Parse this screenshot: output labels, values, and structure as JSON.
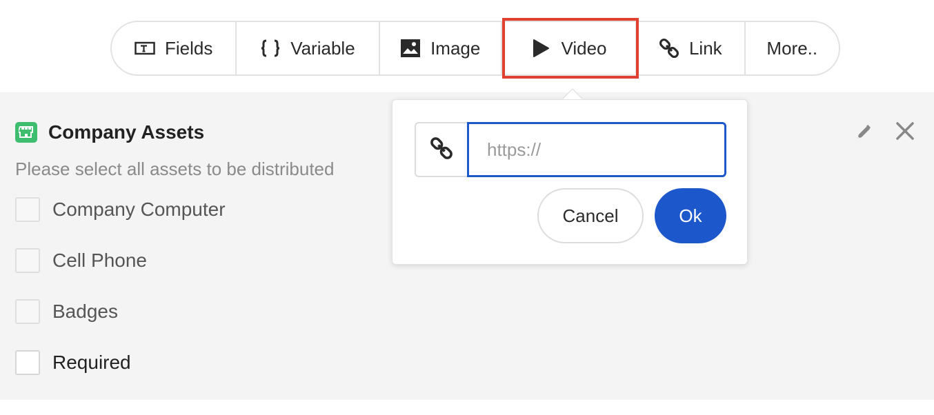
{
  "toolbar": {
    "fields": {
      "label": "Fields",
      "icon": "text-field-icon"
    },
    "variable": {
      "label": "Variable",
      "icon": "braces-icon"
    },
    "image": {
      "label": "Image",
      "icon": "image-icon"
    },
    "video": {
      "label": "Video",
      "icon": "play-icon",
      "highlighted": true
    },
    "link": {
      "label": "Link",
      "icon": "link-icon"
    },
    "more": {
      "label": "More.."
    }
  },
  "panel": {
    "title": "Company Assets",
    "description": "Please select all assets to be distributed",
    "icon": "castle-icon",
    "options": [
      {
        "label": "Company Computer",
        "checked": false
      },
      {
        "label": "Cell Phone",
        "checked": false
      },
      {
        "label": "Badges",
        "checked": false
      }
    ],
    "required": {
      "label": "Required",
      "checked": false
    }
  },
  "popover": {
    "url_placeholder": "https://",
    "url_value": "",
    "cancel_label": "Cancel",
    "ok_label": "Ok"
  },
  "colors": {
    "accent": "#1d57cc",
    "highlight": "#e0402f",
    "badge": "#3ebd6e",
    "panel_bg": "#f4f4f4"
  }
}
